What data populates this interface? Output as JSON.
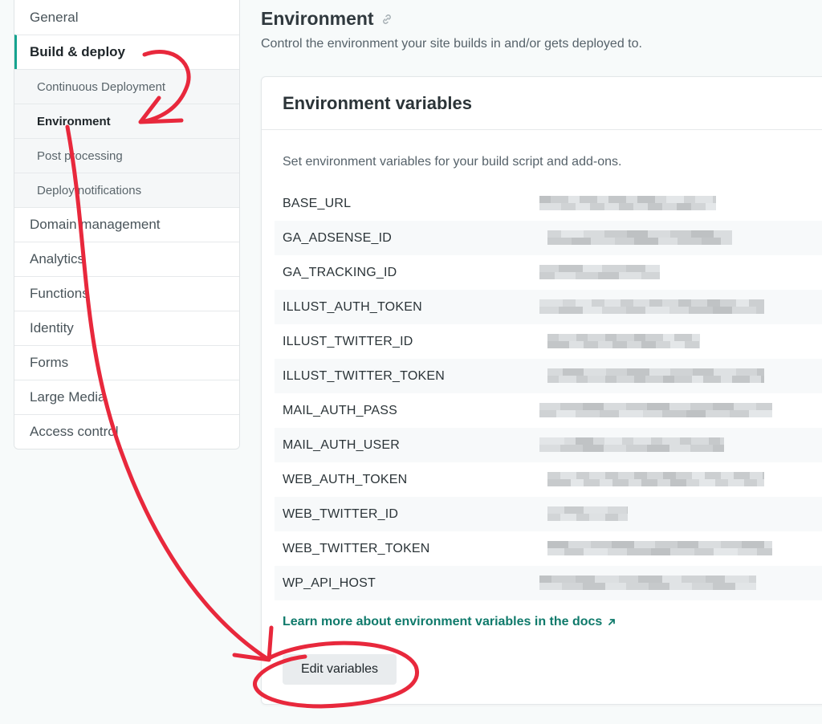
{
  "sidebar": {
    "items": [
      {
        "label": "General"
      },
      {
        "label": "Build & deploy"
      },
      {
        "label": "Continuous Deployment"
      },
      {
        "label": "Environment"
      },
      {
        "label": "Post processing"
      },
      {
        "label": "Deploy notifications"
      },
      {
        "label": "Domain management"
      },
      {
        "label": "Analytics"
      },
      {
        "label": "Functions"
      },
      {
        "label": "Identity"
      },
      {
        "label": "Forms"
      },
      {
        "label": "Large Media"
      },
      {
        "label": "Access control"
      }
    ]
  },
  "main": {
    "title": "Environment",
    "description": "Control the environment your site builds in and/or gets deployed to.",
    "card": {
      "title": "Environment variables",
      "description": "Set environment variables for your build script and add-ons.",
      "variables": [
        {
          "key": "BASE_URL"
        },
        {
          "key": "GA_ADSENSE_ID"
        },
        {
          "key": "GA_TRACKING_ID"
        },
        {
          "key": "ILLUST_AUTH_TOKEN"
        },
        {
          "key": "ILLUST_TWITTER_ID"
        },
        {
          "key": "ILLUST_TWITTER_TOKEN"
        },
        {
          "key": "MAIL_AUTH_PASS"
        },
        {
          "key": "MAIL_AUTH_USER"
        },
        {
          "key": "WEB_AUTH_TOKEN"
        },
        {
          "key": "WEB_TWITTER_ID"
        },
        {
          "key": "WEB_TWITTER_TOKEN"
        },
        {
          "key": "WP_API_HOST"
        }
      ],
      "docs_link": "Learn more about environment variables in the docs",
      "edit_button": "Edit variables"
    }
  },
  "colors": {
    "accent": "#15a38f",
    "link": "#0f7a6b",
    "annotation": "#e8283c"
  }
}
